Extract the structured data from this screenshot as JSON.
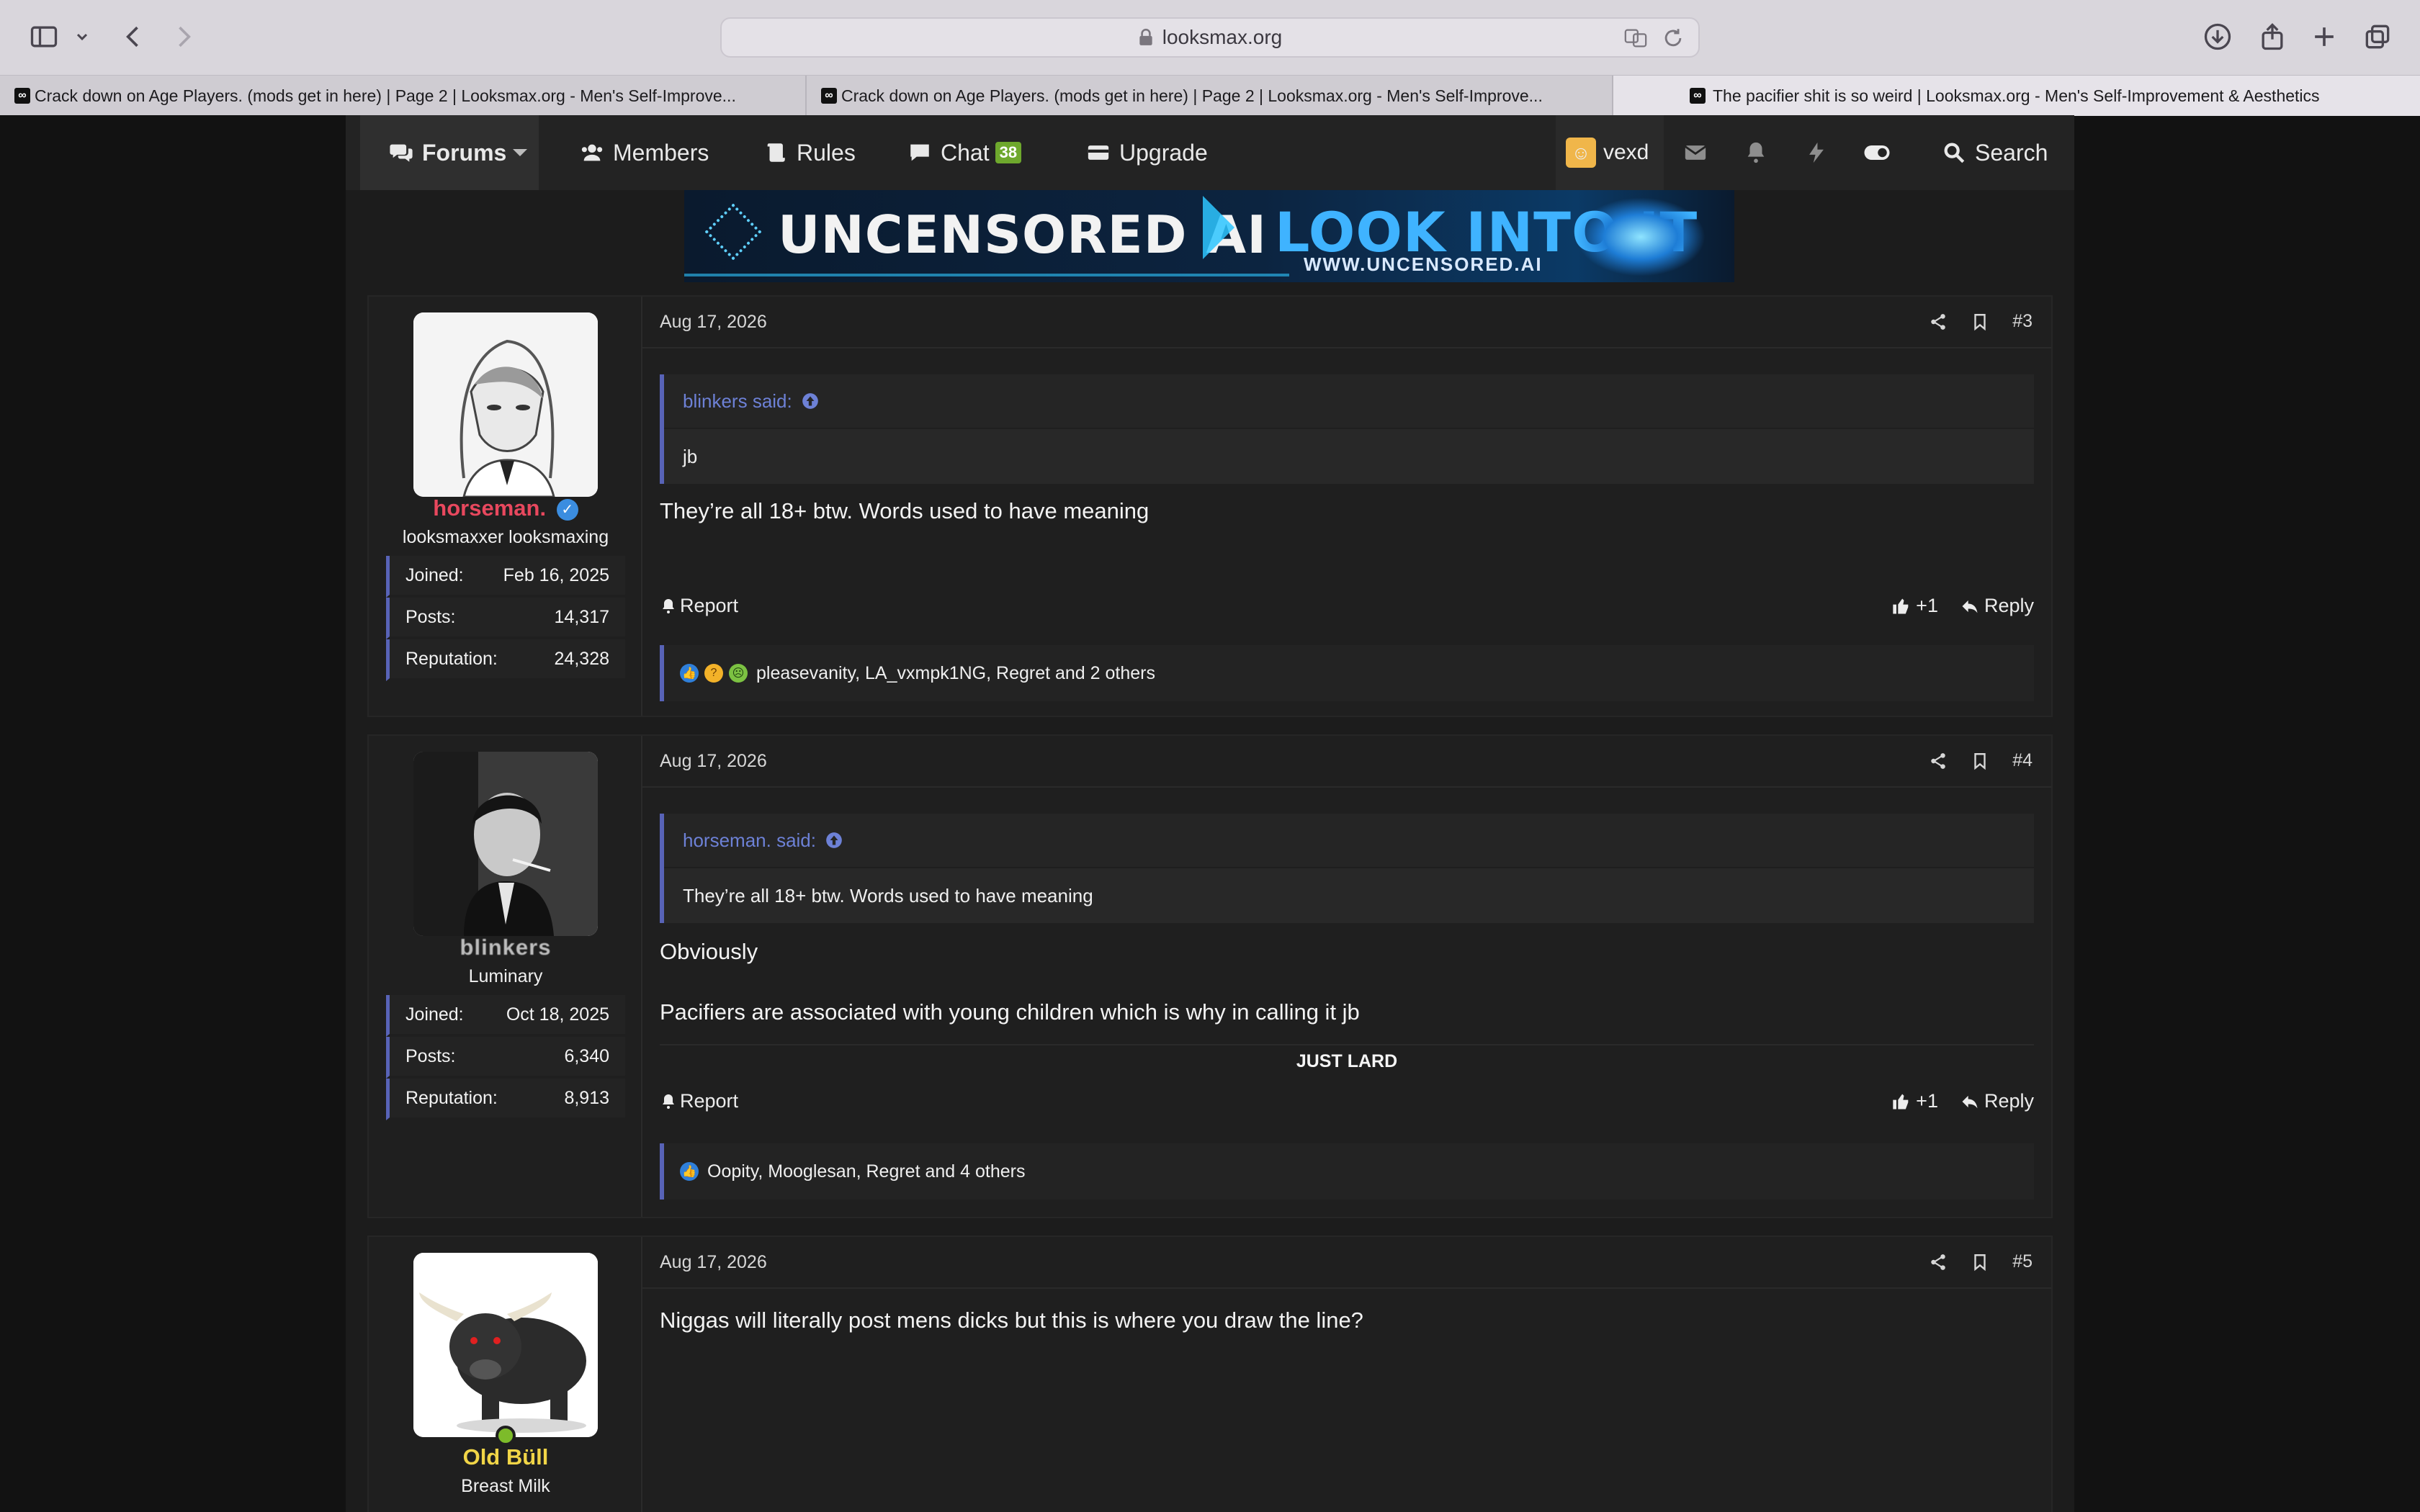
{
  "browser": {
    "url": "looksmax.org",
    "tabs": [
      {
        "title": "Crack down on Age Players. (mods get in here) | Page 2 | Looksmax.org - Men's Self-Improve..."
      },
      {
        "title": "Crack down on Age Players. (mods get in here) | Page 2 | Looksmax.org - Men's Self-Improve..."
      },
      {
        "title": "The pacifier shit is so weird | Looksmax.org - Men's Self-Improvement & Aesthetics"
      }
    ]
  },
  "nav": {
    "forums": "Forums",
    "members": "Members",
    "rules": "Rules",
    "chat": "Chat",
    "chat_count": "38",
    "upgrade": "Upgrade",
    "username": "vexd",
    "search": "Search"
  },
  "banner": {
    "left": "UNCENSORED AI",
    "right": "LOOK INTO IT",
    "sub": "WWW.UNCENSORED.AI"
  },
  "labels": {
    "joined": "Joined:",
    "posts": "Posts:",
    "reputation": "Reputation:",
    "report": "Report",
    "like": "+1",
    "reply": "Reply"
  },
  "posts": [
    {
      "date": "Aug 17, 2026",
      "number": "#3",
      "user": {
        "name": "horseman.",
        "title": "looksmaxxer looksmaxing",
        "joined": "Feb 16, 2025",
        "posts": "14,317",
        "reputation": "24,328",
        "name_color": "#e8485e"
      },
      "quote": {
        "author": "blinkers said:",
        "text": "jb"
      },
      "body": [
        "They’re all 18+ btw. Words used to have meaning"
      ],
      "reactions": "pleasevanity, LA_vxmpk1NG, Regret and 2 others"
    },
    {
      "date": "Aug 17, 2026",
      "number": "#4",
      "user": {
        "name": "blinkers",
        "title": "Luminary",
        "joined": "Oct 18, 2025",
        "posts": "6,340",
        "reputation": "8,913",
        "name_color": "#bdbdbd"
      },
      "quote": {
        "author": "horseman. said:",
        "text": "They’re all 18+ btw. Words used to have meaning"
      },
      "body": [
        "Obviously",
        "Pacifiers are associated with young children which is why in calling it jb"
      ],
      "signature": "JUST LARD",
      "reactions": "Oopity, Mooglesan, Regret and 4 others"
    },
    {
      "date": "Aug 17, 2026",
      "number": "#5",
      "user": {
        "name": "Old Büll",
        "title": "Breast Milk",
        "name_color": "#f1d547"
      },
      "body": [
        "Niggas will literally post mens dicks but this is where you draw the line?"
      ]
    }
  ]
}
